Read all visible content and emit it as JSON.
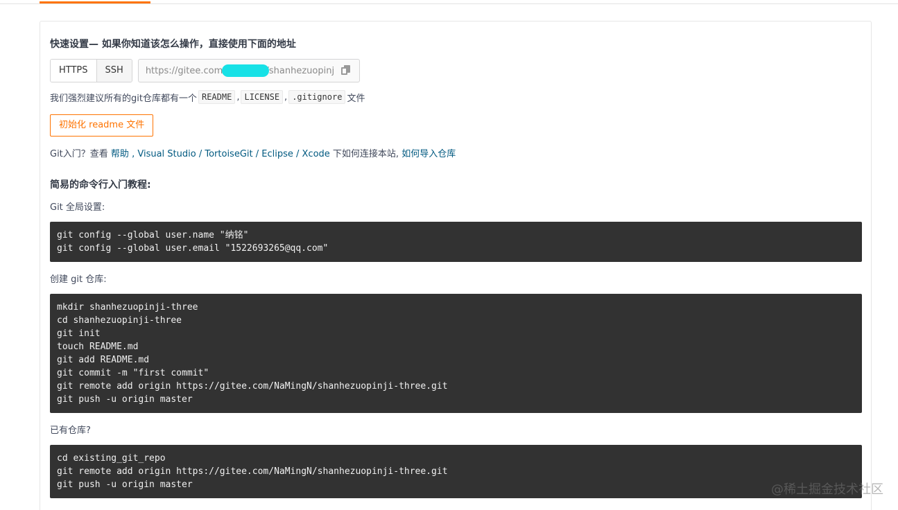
{
  "quick_setup": {
    "heading": "快速设置— 如果你知道该怎么操作，直接使用下面的地址",
    "protocols": [
      "HTTPS",
      "SSH"
    ],
    "active_protocol": "HTTPS",
    "url_value": "https://gitee.com/              /shanhezuopinj",
    "copy_icon": "copy-icon"
  },
  "recommend": {
    "prefix": "我们强烈建议所有的git仓库都有一个",
    "files": [
      "README",
      "LICENSE",
      ".gitignore"
    ],
    "sep1": ",",
    "sep2": ",",
    "suffix": "文件"
  },
  "init_button": "初始化 readme 文件",
  "help": {
    "prefix": "Git入门？查看 ",
    "link_help": "帮助",
    "sep1": " , ",
    "link_vs": "Visual Studio",
    "sep2": " / ",
    "link_tortoise": "TortoiseGit",
    "sep3": " / ",
    "link_eclipse": "Eclipse",
    "sep4": " / ",
    "link_xcode": "Xcode",
    "middle": " 下如何连接本站, ",
    "link_import": "如何导入仓库"
  },
  "tutorial": {
    "title": "简易的命令行入门教程:",
    "global_label": "Git 全局设置:",
    "global_lines": [
      "git config --global user.name \"纳铭\"",
      "git config --global user.email \"1522693265@qq.com\""
    ],
    "create_label": "创建 git 仓库:",
    "create_lines": [
      "mkdir shanhezuopinji-three",
      "cd shanhezuopinji-three",
      "git init",
      "touch README.md",
      "git add README.md",
      "git commit -m \"first commit\"",
      "git remote add origin https://gitee.com/NaMingN/shanhezuopinji-three.git",
      "git push -u origin master"
    ],
    "existing_label": "已有仓库?",
    "existing_lines": [
      "cd existing_git_repo",
      "git remote add origin https://gitee.com/NaMingN/shanhezuopinji-three.git",
      "git push -u origin master"
    ]
  },
  "watermark": "@稀土掘金技术社区",
  "colors": {
    "accent": "#fe7300",
    "link": "#005980",
    "code_bg": "#323232"
  }
}
